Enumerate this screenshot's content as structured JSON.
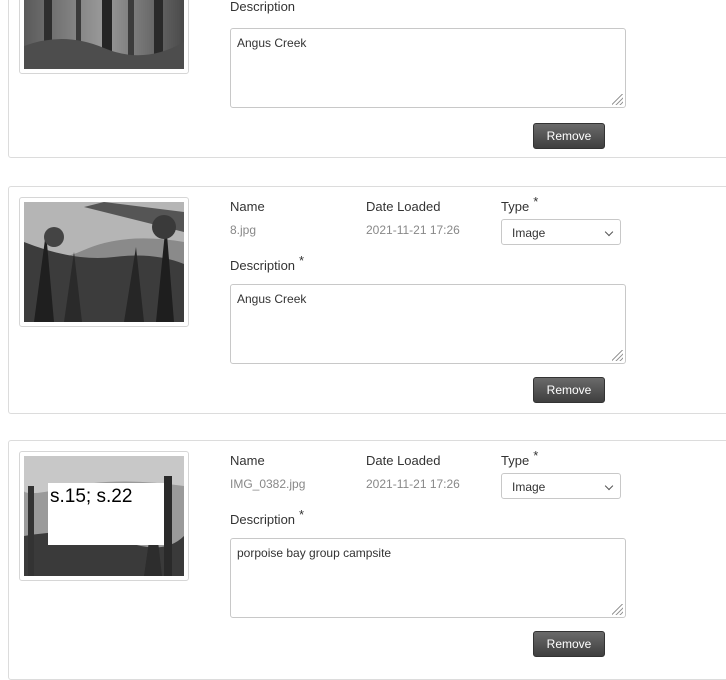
{
  "labels": {
    "name": "Name",
    "date_loaded": "Date Loaded",
    "type": "Type",
    "description": "Description",
    "required": "*",
    "remove": "Remove"
  },
  "entries": [
    {
      "description": "Angus Creek"
    },
    {
      "name": "8.jpg",
      "date_loaded": "2021-11-21 17:26",
      "type": "Image",
      "description": "Angus Creek"
    },
    {
      "name": "IMG_0382.jpg",
      "date_loaded": "2021-11-21 17:26",
      "type": "Image",
      "description": "porpoise bay group campsite",
      "thumb_overlay": "s.15; s.22"
    }
  ],
  "icons": {
    "select_arrow": "chevron-down-icon",
    "resize": "resize-grip-icon"
  }
}
